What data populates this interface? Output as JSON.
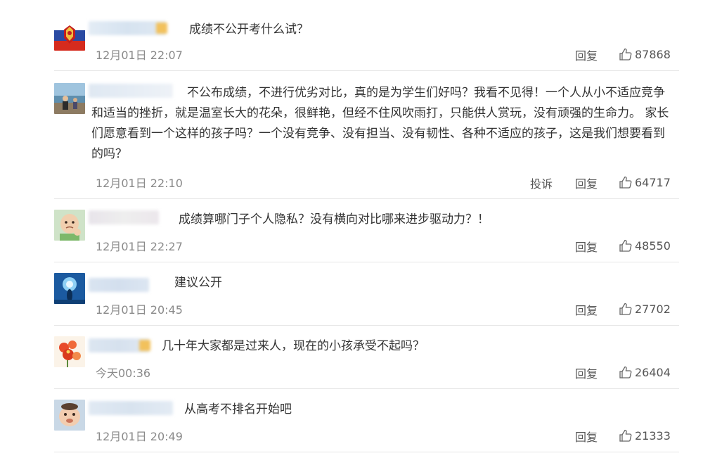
{
  "comments": [
    {
      "text": "成绩不公开考什么试？",
      "time": "12月01日 22:07",
      "reply_label": "回复",
      "likes": "87868",
      "avatar_icon": "flag-emblem-avatar-icon"
    },
    {
      "text": "不公布成绩，不进行优劣对比，真的是为学生们好吗？我看不见得！一个人从小不适应竞争和适当的挫折，就是温室长大的花朵，很鲜艳，但经不住风吹雨打，只能供人赏玩，没有顽强的生命力。 家长们愿意看到一个这样的孩子吗？一个没有竞争、没有担当、没有韧性、各种不适应的孩子，这是我们想要看到的吗？",
      "time": "12月01日 22:10",
      "report_label": "投诉",
      "reply_label": "回复",
      "likes": "64717",
      "avatar_icon": "seaside-person-avatar-icon"
    },
    {
      "text": "成绩算哪门子个人隐私？没有横向对比哪来进步驱动力？！",
      "time": "12月01日 22:27",
      "reply_label": "回复",
      "likes": "48550",
      "avatar_icon": "baby-fist-avatar-icon"
    },
    {
      "text": "建议公开",
      "time": "12月01日 20:45",
      "reply_label": "回复",
      "likes": "27702",
      "avatar_icon": "light-silhouette-avatar-icon"
    },
    {
      "text": "几十年大家都是过来人，现在的小孩承受不起吗？",
      "time": "今天00:36",
      "reply_label": "回复",
      "likes": "26404",
      "avatar_icon": "red-flower-avatar-icon"
    },
    {
      "text": "从高考不排名开始吧",
      "time": "12月01日 20:49",
      "reply_label": "回复",
      "likes": "21333",
      "avatar_icon": "round-face-avatar-icon"
    }
  ],
  "colors": {
    "text": "#333333",
    "muted": "#8a8a8a",
    "action": "#555555",
    "divider": "#e6e6e6",
    "badge": "#f2c15c"
  }
}
